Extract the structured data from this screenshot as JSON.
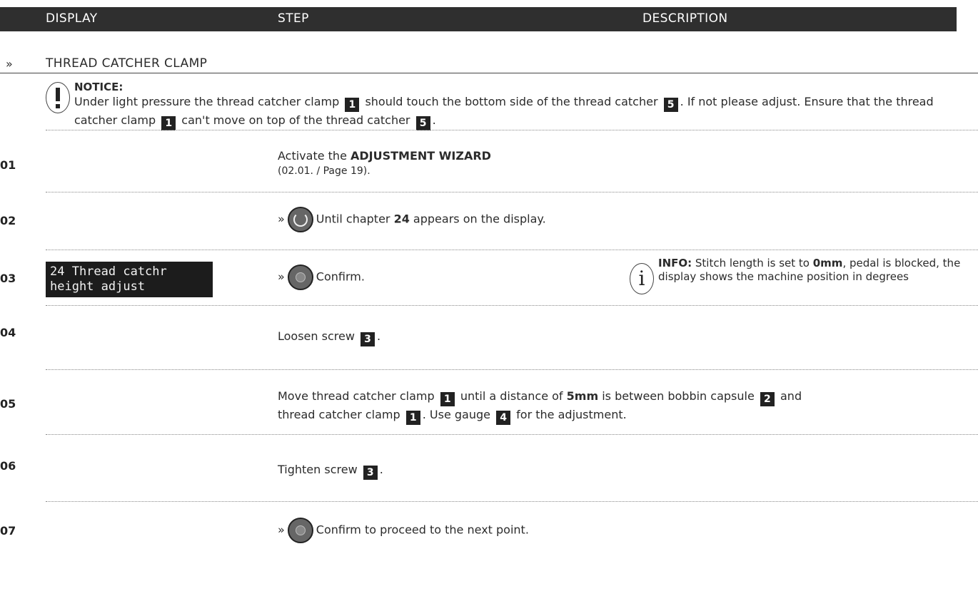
{
  "header": {
    "col_display": "DISPLAY",
    "col_step": "STEP",
    "col_description": "DESCRIPTION"
  },
  "section": {
    "marker": "»",
    "title": "THREAD CATCHER CLAMP"
  },
  "notice": {
    "title": "NOTICE:",
    "t1": "Under light pressure the thread catcher clamp",
    "b1": "1",
    "t2": "should touch the bottom side of the thread catcher",
    "b2": "5",
    "t3": ". If not please adjust. Ensure that the thread catcher clamp",
    "b3": "1",
    "t4": "can't move on top of the thread catcher",
    "b4": "5",
    "t5": "."
  },
  "steps": {
    "s01": {
      "num": "01",
      "t1": "Activate the ",
      "bold": "ADJUSTMENT WIZARD",
      "t2": "(02.01. / Page 19)."
    },
    "s02": {
      "num": "02",
      "marker": "»",
      "t1": "Until chapter ",
      "bold": "24",
      "t2": " appears on the display."
    },
    "s03": {
      "num": "03",
      "display_line1": "24 Thread catchr",
      "display_line2": "height adjust",
      "marker": "»",
      "t1": "Confirm.",
      "info_label": "INFO:",
      "info_t1": " Stitch length is set to ",
      "info_bold": "0mm",
      "info_t2": ", pedal is blocked, the display shows the machine position in degrees"
    },
    "s04": {
      "num": "04",
      "t1": "Loosen screw",
      "b1": "3",
      "t2": "."
    },
    "s05": {
      "num": "05",
      "t1": "Move thread catcher clamp",
      "b1": "1",
      "t2": "until a distance of ",
      "bold": "5mm",
      "t3": " is between bobbin capsule",
      "b2": "2",
      "t4": "and",
      "t5": "thread catcher clamp",
      "b3": "1",
      "t6": ". Use gauge",
      "b4": "4",
      "t7": "for the adjustment."
    },
    "s06": {
      "num": "06",
      "t1": "Tighten screw",
      "b1": "3",
      "t2": "."
    },
    "s07": {
      "num": "07",
      "marker": "»",
      "t1": "Confirm to proceed to the next point."
    }
  },
  "icons": {
    "notice": "exclamation-circle-icon",
    "info": "info-circle-icon",
    "turn": "rotary-knob-turn-icon",
    "press": "rotary-knob-press-icon"
  },
  "colors": {
    "header_bg": "#2f2f2f",
    "badge_bg": "#222222",
    "lcd_bg": "#1c1c1c"
  }
}
